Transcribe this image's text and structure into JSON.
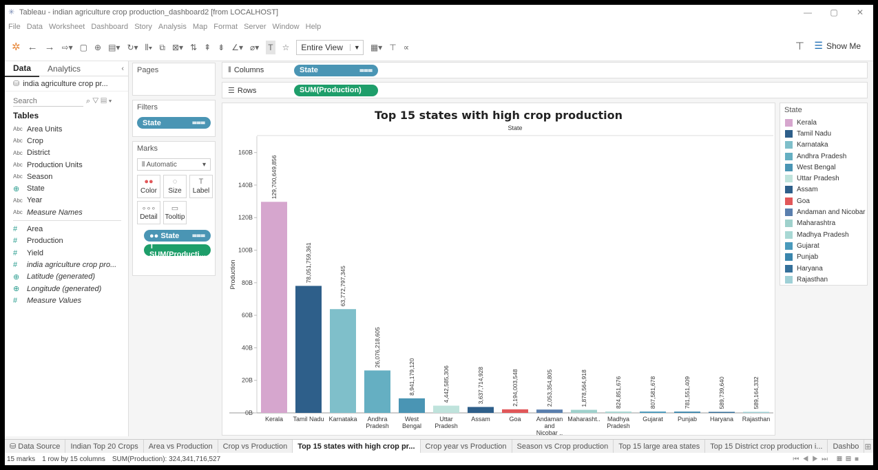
{
  "window": {
    "title": "Tableau - indian agriculture crop production_dashboard2 [from LOCALHOST]",
    "controls": [
      "—",
      "▢",
      "✕"
    ]
  },
  "menu": [
    "File",
    "Data",
    "Worksheet",
    "Dashboard",
    "Story",
    "Analysis",
    "Map",
    "Format",
    "Server",
    "Window",
    "Help"
  ],
  "toolbar": {
    "fit_select": "Entire View",
    "show_me_label": "Show Me"
  },
  "data_pane": {
    "tab_data": "Data",
    "tab_analytics": "Analytics",
    "datasource": "india agriculture crop pr...",
    "search_placeholder": "Search",
    "tables_heading": "Tables",
    "dimensions": [
      {
        "type": "Abc",
        "name": "Area Units"
      },
      {
        "type": "Abc",
        "name": "Crop"
      },
      {
        "type": "Abc",
        "name": "District"
      },
      {
        "type": "Abc",
        "name": "Production Units"
      },
      {
        "type": "Abc",
        "name": "Season"
      },
      {
        "type": "geo",
        "name": "State"
      },
      {
        "type": "Abc",
        "name": "Year"
      },
      {
        "type": "Abc",
        "name": "Measure Names",
        "italic": true
      }
    ],
    "measures": [
      {
        "type": "#",
        "name": "Area"
      },
      {
        "type": "#",
        "name": "Production"
      },
      {
        "type": "#",
        "name": "Yield"
      },
      {
        "type": "#",
        "name": "india agriculture crop pro...",
        "italic": true
      },
      {
        "type": "geo",
        "name": "Latitude (generated)",
        "italic": true
      },
      {
        "type": "geo",
        "name": "Longitude (generated)",
        "italic": true
      },
      {
        "type": "#",
        "name": "Measure Values",
        "italic": true
      }
    ]
  },
  "cards": {
    "pages": "Pages",
    "filters": "Filters",
    "filter_pill": "State",
    "marks": "Marks",
    "mark_type": "Automatic",
    "mark_buttons": [
      {
        "icon": "●●",
        "label": "Color"
      },
      {
        "icon": "◌",
        "label": "Size"
      },
      {
        "icon": "T",
        "label": "Label"
      },
      {
        "icon": "∘∘∘",
        "label": "Detail"
      },
      {
        "icon": "▭",
        "label": "Tooltip"
      }
    ],
    "mark_pill_1": "State",
    "mark_pill_2": "SUM(Producti..."
  },
  "shelves": {
    "columns_label": "Columns",
    "columns_pill": "State",
    "rows_label": "Rows",
    "rows_pill": "SUM(Production)"
  },
  "chart_data": {
    "type": "bar",
    "title": "Top 15 states with high crop production",
    "header": "State",
    "xlabel": "",
    "ylabel": "Production",
    "ylim": [
      0,
      170000000000
    ],
    "yticks": [
      {
        "v": 0,
        "label": "0B"
      },
      {
        "v": 20000000000,
        "label": "20B"
      },
      {
        "v": 40000000000,
        "label": "40B"
      },
      {
        "v": 60000000000,
        "label": "60B"
      },
      {
        "v": 80000000000,
        "label": "80B"
      },
      {
        "v": 100000000000,
        "label": "100B"
      },
      {
        "v": 120000000000,
        "label": "120B"
      },
      {
        "v": 140000000000,
        "label": "140B"
      },
      {
        "v": 160000000000,
        "label": "160B"
      }
    ],
    "categories": [
      [
        "Kerala"
      ],
      [
        "Tamil Nadu"
      ],
      [
        "Karnataka"
      ],
      [
        "Andhra",
        "Pradesh"
      ],
      [
        "West",
        "Bengal"
      ],
      [
        "Uttar",
        "Pradesh"
      ],
      [
        "Assam"
      ],
      [
        "Goa"
      ],
      [
        "Andaman",
        "and",
        "Nicobar .."
      ],
      [
        "Maharasht.."
      ],
      [
        "Madhya",
        "Pradesh"
      ],
      [
        "Gujarat"
      ],
      [
        "Punjab"
      ],
      [
        "Haryana"
      ],
      [
        "Rajasthan"
      ]
    ],
    "values": [
      129700649856,
      78051759361,
      63772797345,
      26076218605,
      8941179120,
      4442585306,
      3637714928,
      2194003548,
      2053354805,
      1878564918,
      824851676,
      807581678,
      781551409,
      589739640,
      589164332
    ],
    "value_labels": [
      "129,700,649,856",
      "78,051,759,361",
      "63,772,797,345",
      "26,076,218,605",
      "8,941,179,120",
      "4,442,585,306",
      "3,637,714,928",
      "2,194,003,548",
      "2,053,354,805",
      "1,878,564,918",
      "824,851,676",
      "807,581,678",
      "781,551,409",
      "589,739,640",
      "589,164,332"
    ],
    "colors": [
      "#d6a6ce",
      "#2e5f8a",
      "#7fbfca",
      "#65afc2",
      "#4a95b4",
      "#bfe3dc",
      "#2e5f8a",
      "#e15759",
      "#5a7fae",
      "#9fd1cc",
      "#a8d8d4",
      "#4a9abc",
      "#3a86ad",
      "#35709a",
      "#9fd0d6"
    ],
    "grid": false,
    "legend_position": "right"
  },
  "legend": {
    "title": "State",
    "items": [
      {
        "label": "Kerala",
        "color": "#d6a6ce"
      },
      {
        "label": "Tamil Nadu",
        "color": "#2e5f8a"
      },
      {
        "label": "Karnataka",
        "color": "#7fbfca"
      },
      {
        "label": "Andhra Pradesh",
        "color": "#65afc2"
      },
      {
        "label": "West Bengal",
        "color": "#4a95b4"
      },
      {
        "label": "Uttar Pradesh",
        "color": "#bfe3dc"
      },
      {
        "label": "Assam",
        "color": "#2e5f8a"
      },
      {
        "label": "Goa",
        "color": "#e15759"
      },
      {
        "label": "Andaman and Nicobar I..",
        "color": "#5a7fae"
      },
      {
        "label": "Maharashtra",
        "color": "#9fd1cc"
      },
      {
        "label": "Madhya Pradesh",
        "color": "#a8d8d4"
      },
      {
        "label": "Gujarat",
        "color": "#4a9abc"
      },
      {
        "label": "Punjab",
        "color": "#3a86ad"
      },
      {
        "label": "Haryana",
        "color": "#35709a"
      },
      {
        "label": "Rajasthan",
        "color": "#9fd0d6"
      }
    ]
  },
  "sheet_tabs": {
    "data_source": "Data Source",
    "tabs": [
      "Indian Top 20 Crops",
      "Area vs Production",
      "Crop vs Production",
      "Top 15 states with high crop pr...",
      "Crop year vs Production",
      "Season vs Crop production",
      "Top 15 large area states",
      "Top 15 District crop production i...",
      "Dashbo"
    ],
    "active": 3
  },
  "status": {
    "marks": "15 marks",
    "layout": "1 row by 15 columns",
    "sum": "SUM(Production): 324,341,716,527"
  }
}
